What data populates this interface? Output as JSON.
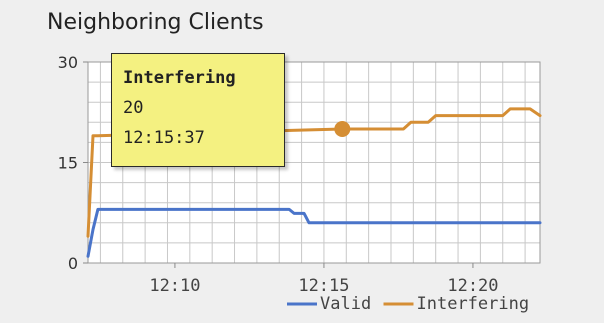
{
  "widget": {
    "title": "Neighboring Clients"
  },
  "colors": {
    "background": "#efefef",
    "plot_background": "#ffffff",
    "grid": "#c8c8c8",
    "valid": "#4a74c9",
    "interfering": "#d58e34",
    "tooltip_bg": "#f4f181"
  },
  "tooltip": {
    "series": "Interfering",
    "value": "20",
    "time": "12:15:37"
  },
  "chart_data": {
    "type": "line",
    "title": "Neighboring Clients",
    "xlabel": "",
    "ylabel": "",
    "ylim": [
      0,
      30
    ],
    "xlim": [
      "12:07:05",
      "12:22:15"
    ],
    "y_ticks": [
      "0",
      "15",
      "30"
    ],
    "x_ticks": [
      "12:10",
      "12:15",
      "12:20"
    ],
    "grid": true,
    "legend_position": "bottom-right",
    "highlighted_point": {
      "series": "Interfering",
      "x": "12:15:37",
      "y": 20
    },
    "series": [
      {
        "name": "Valid",
        "color": "#4a74c9",
        "points": [
          [
            "12:07:05",
            1
          ],
          [
            "12:07:15",
            5
          ],
          [
            "12:07:25",
            8
          ],
          [
            "12:13:50",
            8
          ],
          [
            "12:14:00",
            7.4
          ],
          [
            "12:14:20",
            7.4
          ],
          [
            "12:14:30",
            6
          ],
          [
            "12:22:15",
            6
          ]
        ]
      },
      {
        "name": "Interfering",
        "color": "#d58e34",
        "points": [
          [
            "12:07:05",
            4
          ],
          [
            "12:07:15",
            19
          ],
          [
            "12:07:25",
            19
          ],
          [
            "12:15:37",
            20
          ],
          [
            "12:17:40",
            20
          ],
          [
            "12:17:55",
            21
          ],
          [
            "12:18:30",
            21
          ],
          [
            "12:18:45",
            22
          ],
          [
            "12:21:00",
            22
          ],
          [
            "12:21:15",
            23
          ],
          [
            "12:21:55",
            23
          ],
          [
            "12:22:15",
            22
          ]
        ]
      }
    ]
  }
}
